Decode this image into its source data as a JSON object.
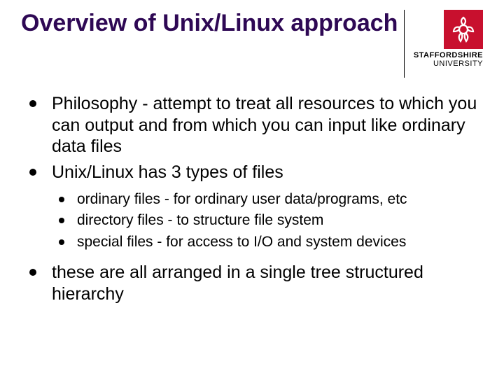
{
  "title": "Overview of Unix/Linux approach",
  "logo": {
    "line1": "STAFFORDSHIRE",
    "line2": "UNIVERSITY"
  },
  "bullets": [
    {
      "text": "Philosophy - attempt to treat all resources to which you can output and from which you can input like ordinary data files"
    },
    {
      "text": "Unix/Linux has 3 types of files",
      "children": [
        {
          "text": "ordinary files - for ordinary user data/programs, etc"
        },
        {
          "text": "directory files - to structure file system"
        },
        {
          "text": "special files - for access to I/O and system devices"
        }
      ]
    },
    {
      "text": "these are all arranged in a single tree structured hierarchy"
    }
  ]
}
